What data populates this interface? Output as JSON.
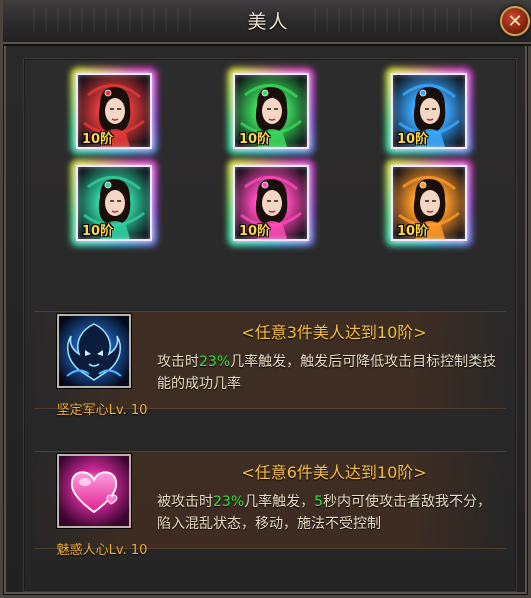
{
  "window": {
    "title": "美人",
    "close_glyph": "✕"
  },
  "beauties": [
    {
      "rank_label": "10阶",
      "theme": "red",
      "color": "#e23a3a"
    },
    {
      "rank_label": "10阶",
      "theme": "green",
      "color": "#3ad85a"
    },
    {
      "rank_label": "10阶",
      "theme": "blue",
      "color": "#3aa8ff"
    },
    {
      "rank_label": "10阶",
      "theme": "teal",
      "color": "#2fd0a0"
    },
    {
      "rank_label": "10阶",
      "theme": "pink",
      "color": "#ff4ab8"
    },
    {
      "rank_label": "10阶",
      "theme": "orange",
      "color": "#ff9a2a"
    }
  ],
  "skills": [
    {
      "icon": "blue-warrior-spirit-icon",
      "name": "坚定军心Lv. 10",
      "heading": "<任意3件美人达到10阶>",
      "desc_parts": [
        "攻击时",
        "23%",
        "几率触发，触发后可降低攻击目标控制类技能的成功几率"
      ],
      "highlight_color": "#3be23b"
    },
    {
      "icon": "pink-heart-icon",
      "name": "魅惑人心Lv. 10",
      "heading": "<任意6件美人达到10阶>",
      "desc_parts": [
        "被攻击时",
        "23%",
        "几率触发，",
        "5",
        "秒内可使攻击者敌我不分，陷入混乱状态，移动，施法不受控制"
      ],
      "highlight_color": "#3be23b"
    }
  ]
}
